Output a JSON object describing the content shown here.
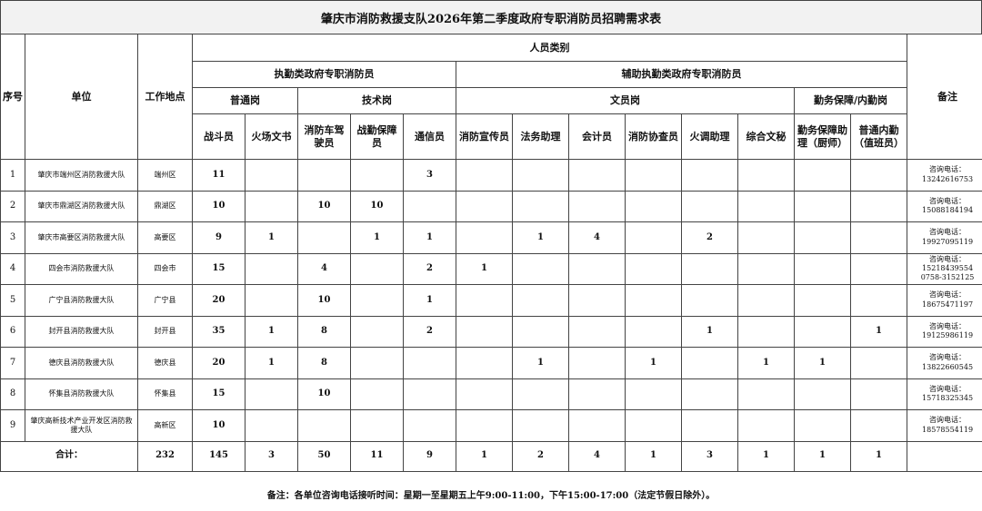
{
  "title": "肇庆市消防救援支队2026年第二季度政府专职消防员招聘需求表",
  "header": {
    "seq": "序号",
    "unit": "单位",
    "place": "工作地点",
    "note": "备注",
    "personnel": "人员类别",
    "duty": "执勤类政府专职消防员",
    "aux": "辅助执勤类政府专职消防员",
    "general": "普通岗",
    "tech": "技术岗",
    "clerk": "文员岗",
    "service": "勤务保障/内勤岗",
    "cols": [
      "战斗员",
      "火场文书",
      "消防车驾驶员",
      "战勤保障员",
      "通信员",
      "消防宣传员",
      "法务助理",
      "会计员",
      "消防协查员",
      "火调助理",
      "综合文秘",
      "勤务保障助理（厨师）",
      "普通内勤（值班员）"
    ]
  },
  "rows": [
    {
      "seq": "1",
      "unit": "肇庆市端州区消防救援大队",
      "place": "端州区",
      "v": [
        "11",
        "",
        "",
        "",
        "3",
        "",
        "",
        "",
        "",
        "",
        "",
        "",
        ""
      ],
      "note": [
        "咨询电话：",
        "13242616753"
      ]
    },
    {
      "seq": "2",
      "unit": "肇庆市鼎湖区消防救援大队",
      "place": "鼎湖区",
      "v": [
        "10",
        "",
        "10",
        "10",
        "",
        "",
        "",
        "",
        "",
        "",
        "",
        "",
        ""
      ],
      "note": [
        "咨询电话：",
        "15088184194"
      ]
    },
    {
      "seq": "3",
      "unit": "肇庆市高要区消防救援大队",
      "place": "高要区",
      "v": [
        "9",
        "1",
        "",
        "1",
        "1",
        "",
        "1",
        "4",
        "",
        "2",
        "",
        "",
        ""
      ],
      "note": [
        "咨询电话：",
        "19927095119"
      ]
    },
    {
      "seq": "4",
      "unit": "四会市消防救援大队",
      "place": "四会市",
      "v": [
        "15",
        "",
        "4",
        "",
        "2",
        "1",
        "",
        "",
        "",
        "",
        "",
        "",
        ""
      ],
      "note": [
        "咨询电话：",
        "15218439554",
        "0758-3152125"
      ]
    },
    {
      "seq": "5",
      "unit": "广宁县消防救援大队",
      "place": "广宁县",
      "v": [
        "20",
        "",
        "10",
        "",
        "1",
        "",
        "",
        "",
        "",
        "",
        "",
        "",
        ""
      ],
      "note": [
        "咨询电话：",
        "18675471197"
      ]
    },
    {
      "seq": "6",
      "unit": "封开县消防救援大队",
      "place": "封开县",
      "v": [
        "35",
        "1",
        "8",
        "",
        "2",
        "",
        "",
        "",
        "",
        "1",
        "",
        "",
        "1"
      ],
      "note": [
        "咨询电话：",
        "19125986119"
      ]
    },
    {
      "seq": "7",
      "unit": "德庆县消防救援大队",
      "place": "德庆县",
      "v": [
        "20",
        "1",
        "8",
        "",
        "",
        "",
        "1",
        "",
        "1",
        "",
        "1",
        "1",
        ""
      ],
      "note": [
        "咨询电话：",
        "13822660545"
      ]
    },
    {
      "seq": "8",
      "unit": "怀集县消防救援大队",
      "place": "怀集县",
      "v": [
        "15",
        "",
        "10",
        "",
        "",
        "",
        "",
        "",
        "",
        "",
        "",
        "",
        ""
      ],
      "note": [
        "咨询电话：",
        "15718325345"
      ]
    },
    {
      "seq": "9",
      "unit": "肇庆高新技术产业开发区消防救援大队",
      "place": "高新区",
      "v": [
        "10",
        "",
        "",
        "",
        "",
        "",
        "",
        "",
        "",
        "",
        "",
        "",
        ""
      ],
      "note": [
        "咨询电话：",
        "18578554119"
      ]
    }
  ],
  "total": {
    "label": "合计：",
    "sum": "232",
    "v": [
      "145",
      "3",
      "50",
      "11",
      "9",
      "1",
      "2",
      "4",
      "1",
      "3",
      "1",
      "1",
      "1"
    ]
  },
  "footer": "备注：各单位咨询电话接听时间：星期一至星期五上午9:00-11:00，下午15:00-17:00（法定节假日除外）。"
}
